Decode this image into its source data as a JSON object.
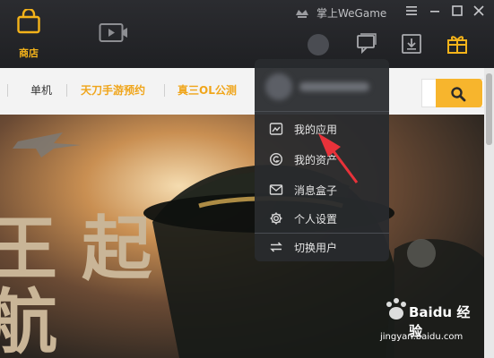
{
  "nav": {
    "shop_label": "商店"
  },
  "window": {
    "mini_label": "掌上WeGame"
  },
  "categories": [
    {
      "label": "单机",
      "hot": false
    },
    {
      "label": "天刀手游预约",
      "hot": true
    },
    {
      "label": "真三OL公测",
      "hot": true
    }
  ],
  "menu": {
    "items": [
      {
        "label": "我的应用",
        "icon": "apps-icon"
      },
      {
        "label": "我的资产",
        "icon": "assets-icon"
      },
      {
        "label": "消息盒子",
        "icon": "mail-icon"
      },
      {
        "label": "个人设置",
        "icon": "gear-icon"
      },
      {
        "label": "切换用户",
        "icon": "switch-user-icon"
      }
    ]
  },
  "banner": {
    "art_text": "王 起航"
  },
  "watermark": {
    "brand": "Baidu 经验",
    "url": "jingyan.baidu.com"
  },
  "colors": {
    "accent": "#f7b52d",
    "accent_text": "#f0a51a",
    "titlebar": "#25262a",
    "arrow": "#e8323a"
  }
}
